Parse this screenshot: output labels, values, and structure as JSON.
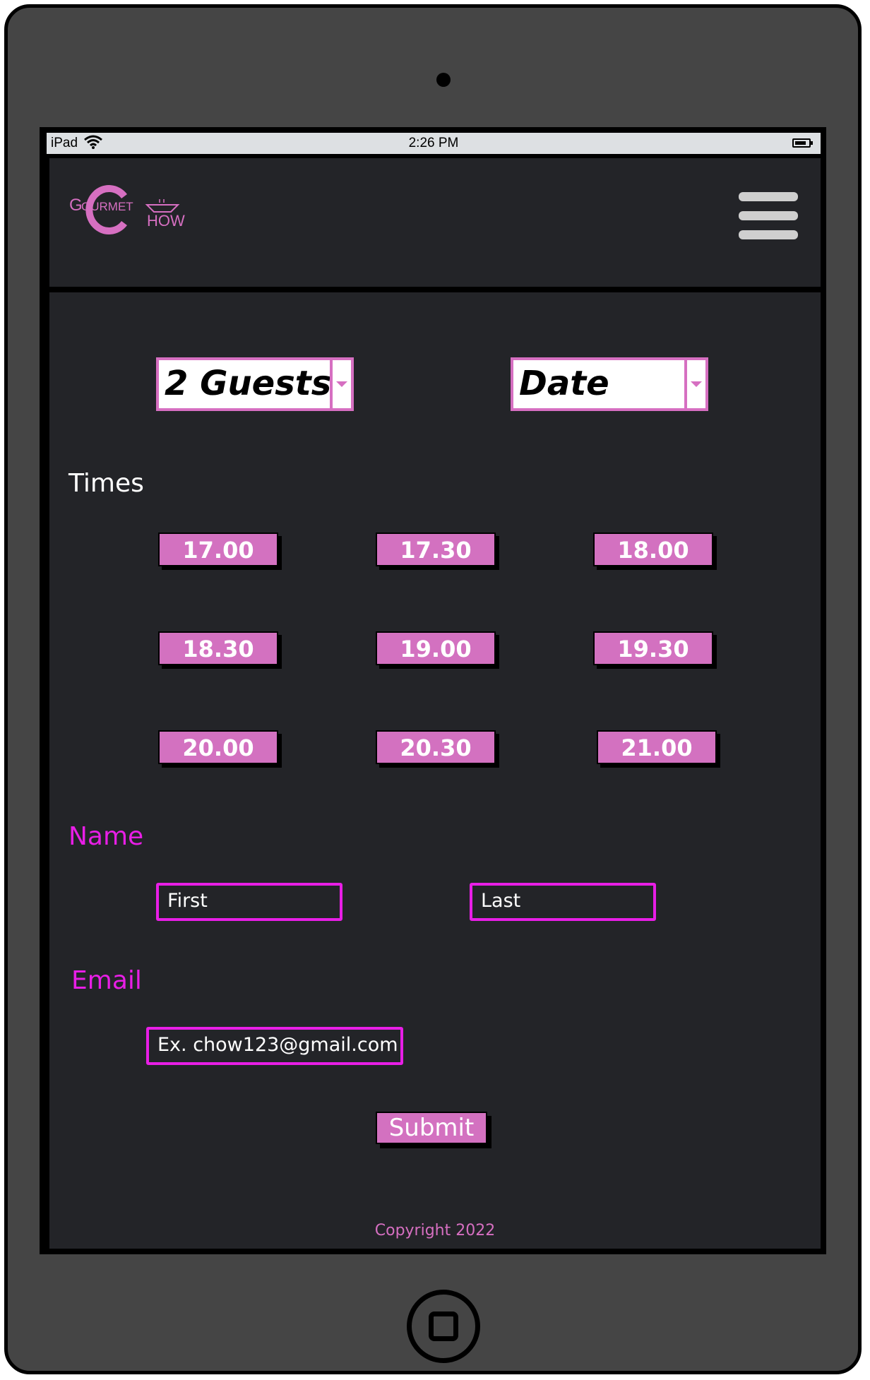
{
  "statusbar": {
    "device": "iPad",
    "time": "2:26 PM"
  },
  "header": {
    "logo_parts": [
      "G",
      "OURMET",
      "C",
      "HOW"
    ],
    "menu_icon": "hamburger-menu-icon"
  },
  "booking": {
    "guests_select": "2 Guests",
    "date_select": "Date",
    "times_label": "Times",
    "times": [
      "17.00",
      "17.30",
      "18.00",
      "18.30",
      "19.00",
      "19.30",
      "20.00",
      "20.30",
      "21.00"
    ],
    "name_label": "Name",
    "first_placeholder": "First",
    "last_placeholder": "Last",
    "email_label": "Email",
    "email_placeholder": "Ex. chow123@gmail.com",
    "submit_label": "Submit"
  },
  "footer": {
    "copyright": "Copyright 2022"
  },
  "colors": {
    "accent": "#d371c0",
    "magenta": "#e81ee6",
    "background": "#232428",
    "device": "#454545"
  }
}
